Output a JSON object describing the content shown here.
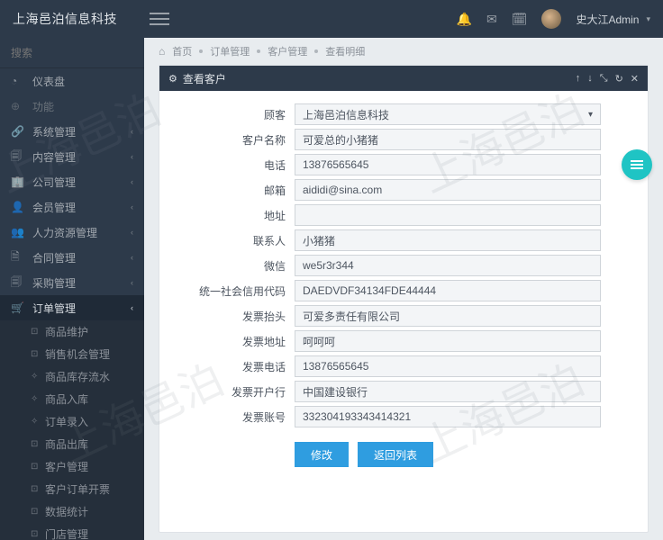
{
  "watermark_text": "上海邑泊",
  "brand": "上海邑泊信息科技",
  "user": {
    "name": "史大江Admin"
  },
  "search": {
    "placeholder": "搜索"
  },
  "sidebar": {
    "items": [
      {
        "icon": "◔",
        "label": "仪表盘",
        "chev": false,
        "dim": false
      },
      {
        "icon": "⊕",
        "label": "功能",
        "chev": false,
        "dim": true
      },
      {
        "icon": "🔗",
        "label": "系统管理",
        "chev": true
      },
      {
        "icon": "🗐",
        "label": "内容管理",
        "chev": true
      },
      {
        "icon": "🏢",
        "label": "公司管理",
        "chev": true
      },
      {
        "icon": "👤",
        "label": "会员管理",
        "chev": true
      },
      {
        "icon": "👥",
        "label": "人力资源管理",
        "chev": true
      },
      {
        "icon": "🗎",
        "label": "合同管理",
        "chev": true
      },
      {
        "icon": "🗐",
        "label": "采购管理",
        "chev": true
      },
      {
        "icon": "🛒",
        "label": "订单管理",
        "chev": true,
        "active": true
      }
    ],
    "sub": [
      {
        "label": "商品维护"
      },
      {
        "label": "销售机会管理"
      },
      {
        "label": "商品库存流水"
      },
      {
        "label": "商品入库"
      },
      {
        "label": "订单录入"
      },
      {
        "label": "商品出库"
      },
      {
        "label": "客户管理"
      },
      {
        "label": "客户订单开票"
      },
      {
        "label": "数据统计"
      },
      {
        "label": "门店管理"
      }
    ]
  },
  "crumbs": {
    "home": "首页",
    "a": "订单管理",
    "b": "客户管理",
    "c": "查看明细"
  },
  "panel": {
    "title": "查看客户",
    "buttons": {
      "edit": "修改",
      "back": "返回列表"
    }
  },
  "fields": [
    {
      "label": "顾客",
      "value": "上海邑泊信息科技",
      "select": true
    },
    {
      "label": "客户名称",
      "value": "可爱总的小猪猪"
    },
    {
      "label": "电话",
      "value": "13876565645"
    },
    {
      "label": "邮箱",
      "value": "aididi@sina.com"
    },
    {
      "label": "地址",
      "value": ""
    },
    {
      "label": "联系人",
      "value": "小猪猪"
    },
    {
      "label": "微信",
      "value": "we5r3r344"
    },
    {
      "label": "统一社会信用代码",
      "value": "DAEDVDF34134FDE44444"
    },
    {
      "label": "发票抬头",
      "value": "可爱多责任有限公司"
    },
    {
      "label": "发票地址",
      "value": "呵呵呵"
    },
    {
      "label": "发票电话",
      "value": "13876565645"
    },
    {
      "label": "发票开户行",
      "value": "中国建设银行"
    },
    {
      "label": "发票账号",
      "value": "332304193343414321"
    }
  ]
}
